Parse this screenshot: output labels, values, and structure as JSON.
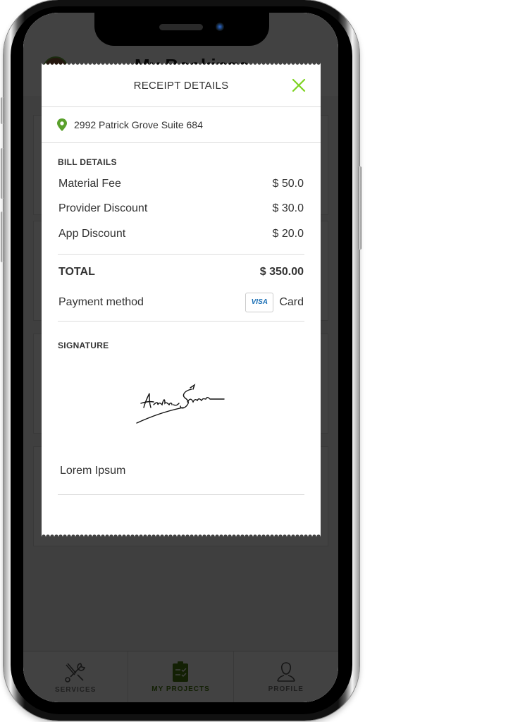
{
  "background": {
    "title": "My Bookings",
    "tabbar": [
      {
        "label": "SERVICES",
        "icon": "tools-icon",
        "active": false
      },
      {
        "label": "MY PROJECTS",
        "icon": "clipboard-check-icon",
        "active": true
      },
      {
        "label": "PROFILE",
        "icon": "user-icon",
        "active": false
      }
    ]
  },
  "modal": {
    "title": "RECEIPT DETAILS",
    "address": "2992 Patrick Grove Suite 684",
    "bill_details_title": "BILL DETAILS",
    "bill_items": [
      {
        "label": "Material Fee",
        "amount": "$ 50.0"
      },
      {
        "label": "Provider Discount",
        "amount": "$ 30.0"
      },
      {
        "label": "App Discount",
        "amount": "$ 20.0"
      }
    ],
    "total_label": "TOTAL",
    "total_amount": "$ 350.00",
    "payment_label": "Payment method",
    "payment_card_brand": "VISA",
    "payment_method": "Card",
    "signature_title": "SIGNATURE",
    "signer_name": "Lorem Ipsum"
  },
  "colors": {
    "accent": "#7ed321",
    "pin": "#5aa02c",
    "active_tab": "#4a7d13",
    "visa": "#1a6fb5"
  }
}
